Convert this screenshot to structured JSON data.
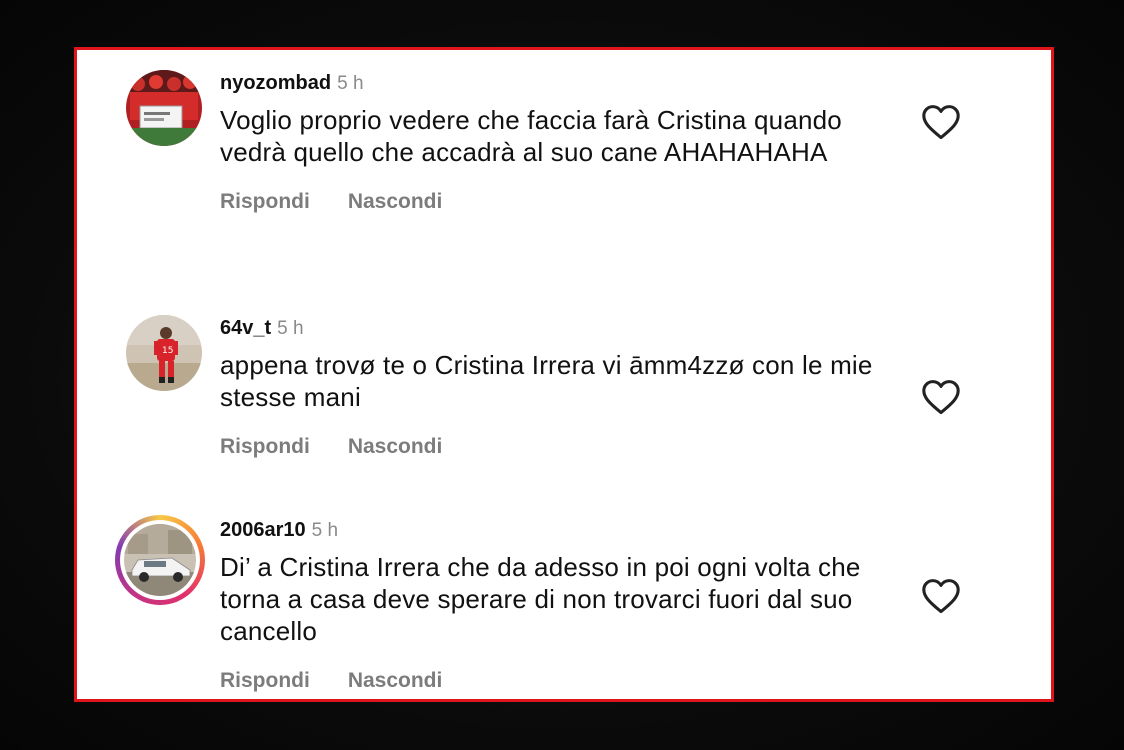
{
  "comments": [
    {
      "username": "nyozombad",
      "time": "5 h",
      "text": "Voglio proprio vedere che faccia farà Cristina quando vedrà quello che accadrà al suo cane AHAHAHAHA",
      "reply_label": "Rispondi",
      "hide_label": "Nascondi",
      "avatar_icon": "team-photo-avatar",
      "liked": false
    },
    {
      "username": "64v_t",
      "time": "5 h",
      "text": "appena trovø te o Cristina Irrera vi āmm4zzø con le mie stesse mani",
      "reply_label": "Rispondi",
      "hide_label": "Nascondi",
      "avatar_icon": "football-player-avatar",
      "liked": false
    },
    {
      "username": "2006ar10",
      "time": "5 h",
      "text": "Di’ a Cristina Irrera che da adesso in poi ogni volta che torna a casa deve sperare di non trovarci fuori dal suo cancello",
      "reply_label": "Rispondi",
      "hide_label": "Nascondi",
      "avatar_icon": "white-car-avatar",
      "story_ring": true,
      "liked": false
    }
  ],
  "colors": {
    "border": "#e0141b",
    "text": "#111111",
    "muted": "#8a8a8a",
    "action": "#7c7c7c"
  }
}
